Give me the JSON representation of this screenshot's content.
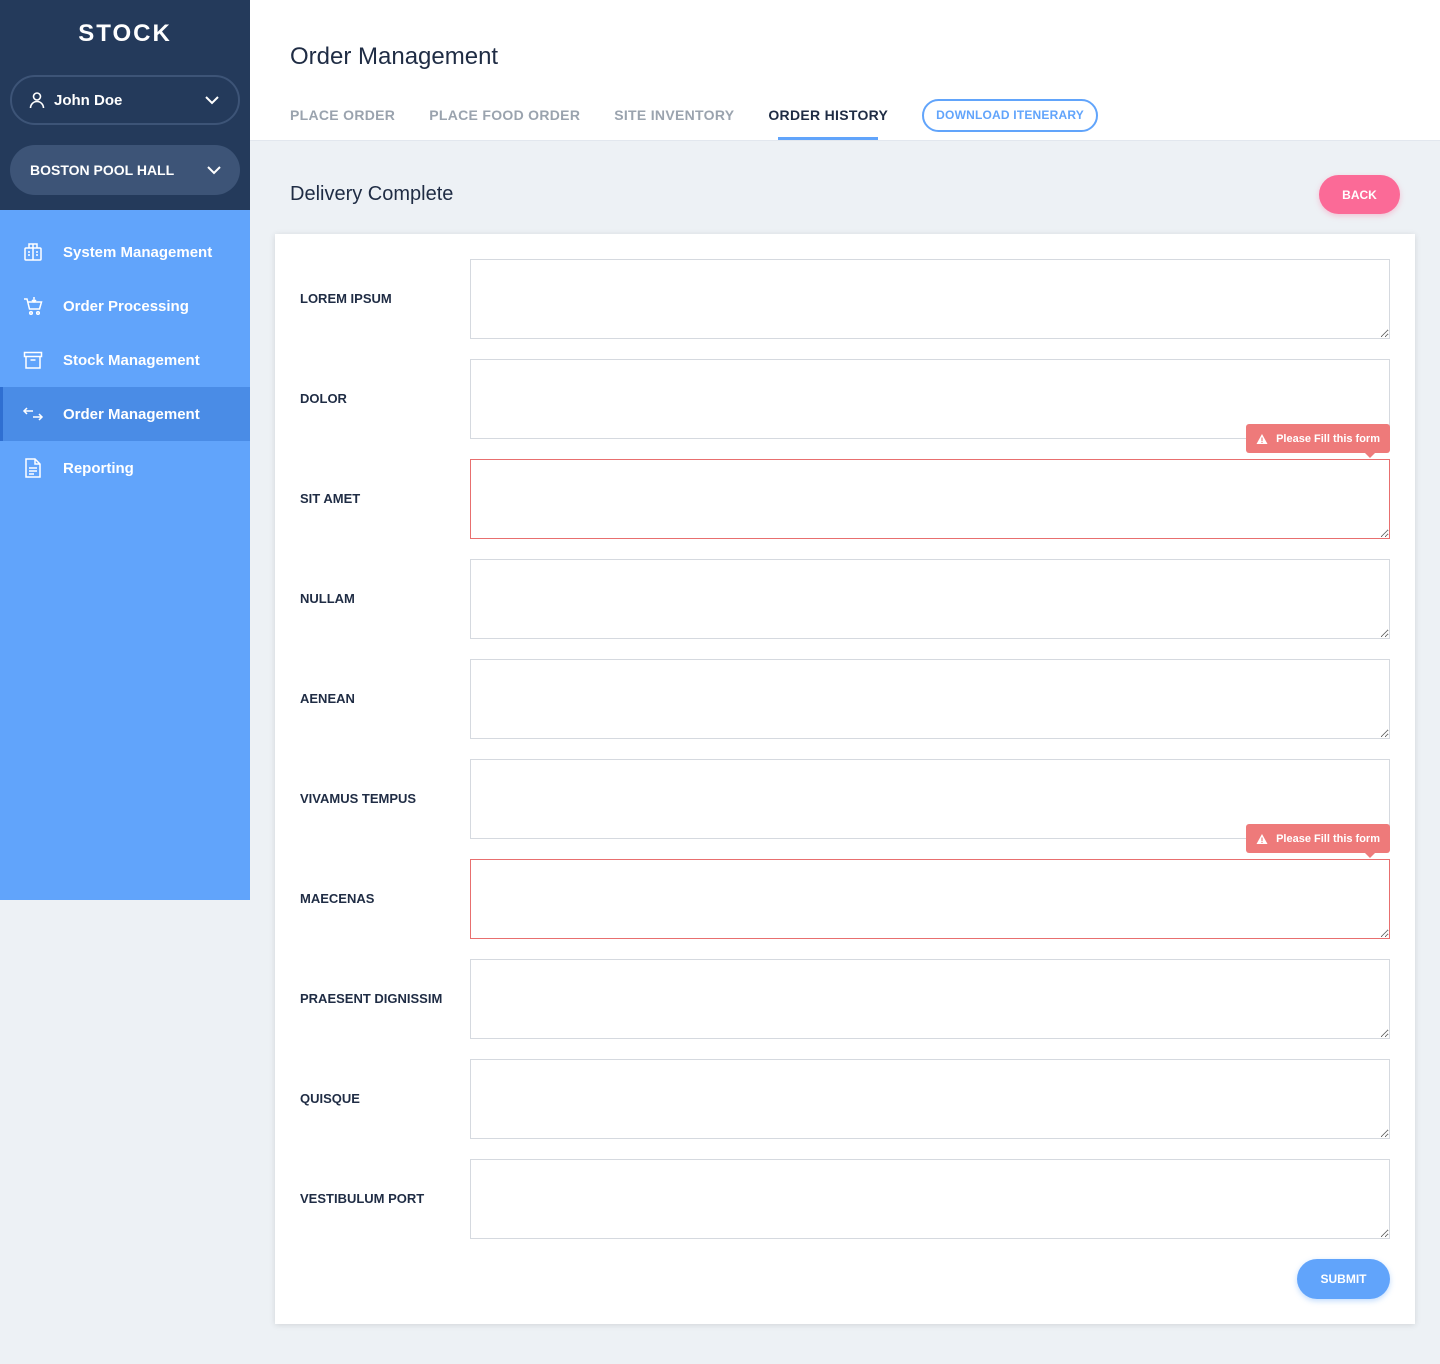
{
  "brand": "STOCK",
  "user": {
    "name": "John Doe",
    "icon": "user-icon"
  },
  "site": {
    "name": "BOSTON POOL HALL"
  },
  "nav": [
    {
      "label": "System Management",
      "icon": "building-icon",
      "active": false
    },
    {
      "label": "Order Processing",
      "icon": "cart-icon",
      "active": false
    },
    {
      "label": "Stock Management",
      "icon": "archive-box-icon",
      "active": false
    },
    {
      "label": "Order Management",
      "icon": "swap-arrows-icon",
      "active": true
    },
    {
      "label": "Reporting",
      "icon": "document-icon",
      "active": false
    }
  ],
  "header": {
    "title": "Order Management",
    "tabs": [
      {
        "label": "PLACE ORDER",
        "active": false
      },
      {
        "label": "PLACE FOOD ORDER",
        "active": false
      },
      {
        "label": "SITE INVENTORY",
        "active": false
      },
      {
        "label": "ORDER HISTORY",
        "active": true
      }
    ],
    "download_label": "DOWNLOAD ITENERARY"
  },
  "section": {
    "title": "Delivery Complete",
    "back_label": "BACK"
  },
  "form": {
    "fields": [
      {
        "label": "LOREM IPSUM",
        "value": "",
        "error": false
      },
      {
        "label": "DOLOR",
        "value": "",
        "error": false
      },
      {
        "label": "SIT AMET",
        "value": "",
        "error": true,
        "error_text": "Please Fill this form"
      },
      {
        "label": "NULLAM",
        "value": "",
        "error": false
      },
      {
        "label": "AENEAN",
        "value": "",
        "error": false
      },
      {
        "label": "VIVAMUS TEMPUS",
        "value": "",
        "error": false
      },
      {
        "label": "MAECENAS",
        "value": "",
        "error": true,
        "error_text": "Please Fill this form"
      },
      {
        "label": "PRAESENT DIGNISSIM",
        "value": "",
        "error": false
      },
      {
        "label": "QUISQUE",
        "value": "",
        "error": false
      },
      {
        "label": "VESTIBULUM PORT",
        "value": "",
        "error": false
      }
    ],
    "submit_label": "SUBMIT"
  },
  "colors": {
    "sidebar_dark": "#243a5b",
    "sidebar_blue": "#61a4fb",
    "accent": "#61a4fb",
    "back_button": "#fb6a97",
    "error": "#ee7a7a"
  }
}
